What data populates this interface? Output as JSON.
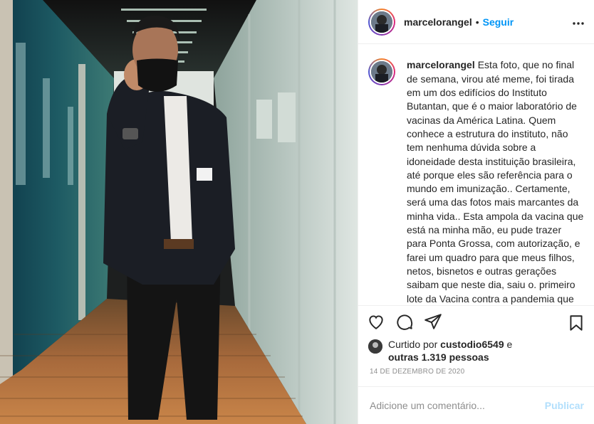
{
  "post": {
    "photo_alt": "",
    "header": {
      "username": "marcelorangel",
      "separator": "•",
      "follow_label": "Seguir",
      "more_icon": "more-horizontal-icon"
    },
    "caption": {
      "username": "marcelorangel",
      "text": "Esta foto, que no final de semana, virou até meme, foi tirada em um dos edifícios do Instituto Butantan, que é o maior laboratório de vacinas da América Latina. Quem conhece a estrutura do instituto, não tem nenhuma dúvida sobre a idoneidade desta instituição brasileira, até porque eles são referência para o mundo em imunização.. Certamente, será uma das fotos mais marcantes da minha vida.. Esta ampola da vacina que está na minha mão, eu pude trazer para Ponta Grossa, com autorização, e farei um quadro para que meus filhos, netos, bisnetos e outras gerações saibam que neste dia, saiu o. primeiro lote da Vacina contra a pandemia que assolou o mundo"
    },
    "actions": {
      "like_icon": "heart-icon",
      "comment_icon": "comment-icon",
      "share_icon": "share-icon",
      "save_icon": "bookmark-icon"
    },
    "likes": {
      "prefix": "Curtido por",
      "user": "custodio6549",
      "connector": "e",
      "others": "outras 1.319 pessoas"
    },
    "date": "14 DE DEZEMBRO DE 2020",
    "comment": {
      "placeholder": "Adicione um comentário...",
      "publish_label": "Publicar"
    },
    "colors": {
      "follow": "#0095f6",
      "publish_disabled": "#b2dffc",
      "meta_gray": "#8e8e8e"
    }
  }
}
